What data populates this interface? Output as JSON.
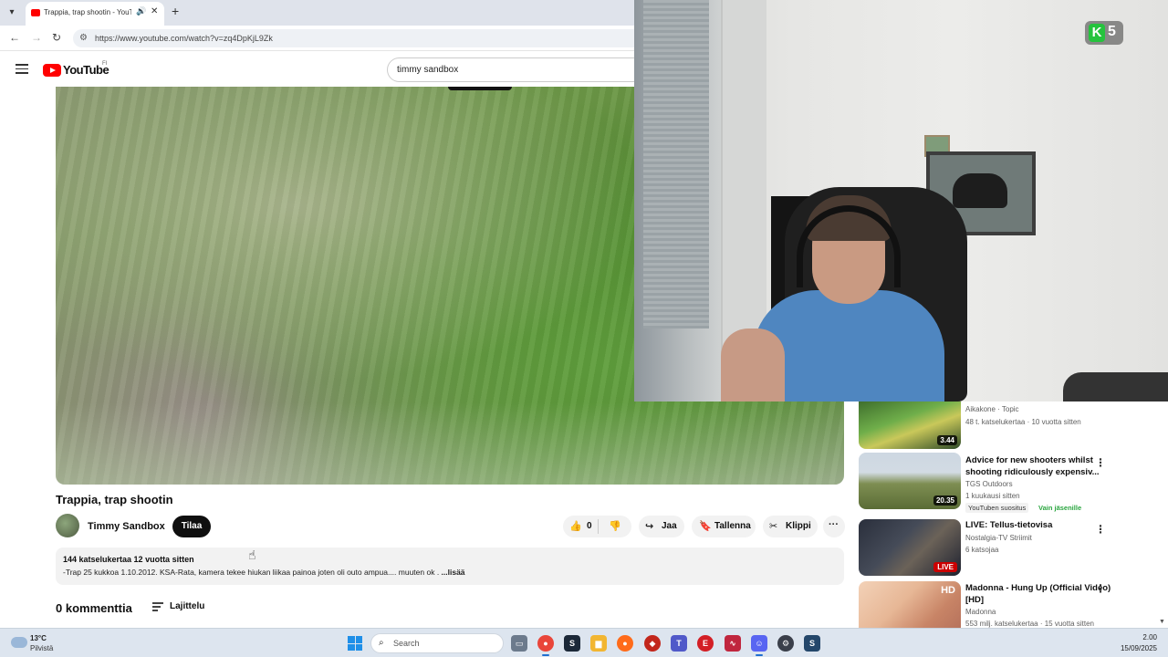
{
  "browser": {
    "tab_title": "Trappia, trap shootin - YouTube",
    "url": "https://www.youtube.com/watch?v=zq4DpKjL9Zk"
  },
  "youtube": {
    "logo_text": "YouTube",
    "region": "FI",
    "search_value": "timmy sandbox"
  },
  "overlay": {
    "badge_letter": "K",
    "badge_number": "5"
  },
  "video": {
    "title": "Trappia, trap shootin",
    "channel": "Timmy Sandbox",
    "subscribe_label": "Tilaa",
    "like_count": "0",
    "share_label": "Jaa",
    "save_label": "Tallenna",
    "clip_label": "Klippi",
    "meta": "144 katselukertaa  12 vuotta sitten",
    "description": "-Trap 25 kukkoa 1.10.2012. KSA-Rata, kamera tekee hiukan liikaa painoa joten oli outo ampua.... muuten ok . ",
    "more_label": "...lisää",
    "comments_count": "0 kommenttia",
    "sort_label": "Lajittelu"
  },
  "recommendations": [
    {
      "title": "",
      "channel": "Aikakone · Topic",
      "stats": "48 t. katselukertaa · 10 vuotta sitten",
      "duration": "3.44"
    },
    {
      "title": "Advice for new shooters whilst shooting ridiculously expensiv...",
      "channel": "TGS Outdoors",
      "stats": "1 kuukausi sitten",
      "badge": "YouTuben suositus",
      "members": "Vain jäsenille",
      "duration": "20.35"
    },
    {
      "title": "LIVE: Tellus-tietovisa",
      "channel": "Nostalgia-TV Striimit",
      "stats": "6 katsojaa",
      "live_label": "LIVE"
    },
    {
      "title": "Madonna - Hung Up (Official Video) [HD]",
      "channel": "Madonna",
      "stats": "553 milj. katselukertaa · 15 vuotta sitten"
    }
  ],
  "taskbar": {
    "weather_temp": "13°C",
    "weather_desc": "Pilvistä",
    "search_placeholder": "Search",
    "time": "2.00",
    "date": "15/09/2025"
  }
}
